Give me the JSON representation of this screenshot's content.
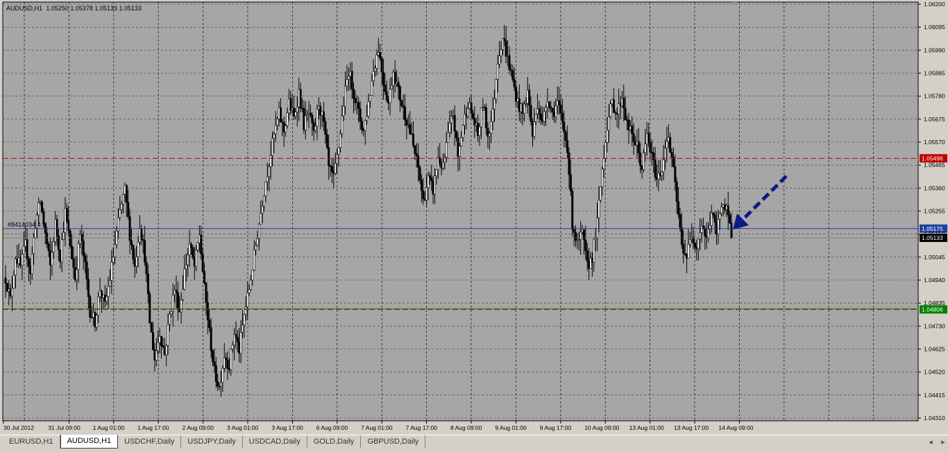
{
  "header": {
    "symbol_label": "AUDUSD,H1",
    "ohlc": "1.05250 1.05378 1.05133 1.05133"
  },
  "order_label": "#8414034 4 sl",
  "colors": {
    "background": "#a6a6a6",
    "grid": "#3a3a3a",
    "candle": "#000000",
    "resistance": "#c00000",
    "support": "#008000",
    "order_line": "#1f3f9f",
    "arrow": "#0b1a88"
  },
  "chart_data": {
    "type": "candlestick",
    "symbol": "AUDUSD",
    "timeframe": "H1",
    "ylim": [
      1.0431,
      1.062
    ],
    "y_ticks": [
      "1.06200",
      "1.06095",
      "1.05990",
      "1.05885",
      "1.05780",
      "1.05675",
      "1.05570",
      "1.05465",
      "1.05360",
      "1.05255",
      "1.05150",
      "1.05045",
      "1.04940",
      "1.04835",
      "1.04730",
      "1.04625",
      "1.04520",
      "1.04415",
      "1.04310"
    ],
    "x_ticks": [
      "30 Jul 2012",
      "31 Jul 09:00",
      "1 Aug 01:00",
      "1 Aug 17:00",
      "2 Aug 09:00",
      "3 Aug 01:00",
      "3 Aug 17:00",
      "6 Aug 09:00",
      "7 Aug 01:00",
      "7 Aug 17:00",
      "8 Aug 09:00",
      "9 Aug 01:00",
      "9 Aug 17:00",
      "10 Aug 09:00",
      "13 Aug 01:00",
      "13 Aug 17:00",
      "14 Aug 09:00"
    ],
    "price_levels": [
      {
        "name": "resistance",
        "value": 1.05496,
        "label": "1.05496"
      },
      {
        "name": "order",
        "value": 1.05175,
        "label": "1.05175"
      },
      {
        "name": "current",
        "value": 1.05133,
        "label": "1.05133"
      },
      {
        "name": "support",
        "value": 1.04806,
        "label": "1.04806"
      }
    ],
    "close_path": [
      1.0495,
      1.0485,
      1.0505,
      1.05,
      1.051,
      1.0498,
      1.052,
      1.053,
      1.0515,
      1.05,
      1.052,
      1.0505,
      1.0525,
      1.051,
      1.0495,
      1.0515,
      1.05,
      1.048,
      1.0475,
      1.049,
      1.0482,
      1.0495,
      1.051,
      1.0525,
      1.0535,
      1.0515,
      1.05,
      1.052,
      1.0505,
      1.0475,
      1.0458,
      1.047,
      1.046,
      1.0478,
      1.049,
      1.048,
      1.0498,
      1.051,
      1.05,
      1.0515,
      1.049,
      1.047,
      1.0452,
      1.0445,
      1.046,
      1.0455,
      1.047,
      1.0462,
      1.0478,
      1.049,
      1.0505,
      1.052,
      1.0535,
      1.0548,
      1.056,
      1.057,
      1.0562,
      1.0575,
      1.0568,
      1.058,
      1.0565,
      1.057,
      1.056,
      1.0575,
      1.0565,
      1.0545,
      1.054,
      1.0555,
      1.0575,
      1.059,
      1.058,
      1.057,
      1.0562,
      1.0575,
      1.059,
      1.06,
      1.0585,
      1.0575,
      1.059,
      1.058,
      1.0572,
      1.0565,
      1.0555,
      1.0545,
      1.053,
      1.054,
      1.0535,
      1.055,
      1.0545,
      1.056,
      1.057,
      1.055,
      1.0565,
      1.0575,
      1.0568,
      1.056,
      1.0575,
      1.056,
      1.057,
      1.0595,
      1.0605,
      1.0595,
      1.0585,
      1.0575,
      1.057,
      1.058,
      1.056,
      1.0575,
      1.0565,
      1.0578,
      1.057,
      1.0575,
      1.0565,
      1.0555,
      1.052,
      1.051,
      1.0515,
      1.05,
      1.0505,
      1.052,
      1.0545,
      1.0565,
      1.0575,
      1.057,
      1.0578,
      1.0565,
      1.056,
      1.0555,
      1.0545,
      1.056,
      1.055,
      1.054,
      1.0545,
      1.056,
      1.055,
      1.053,
      1.051,
      1.0505,
      1.0515,
      1.051,
      1.052,
      1.0512,
      1.0525,
      1.0515,
      1.053,
      1.0525,
      1.0515
    ]
  },
  "tabs": [
    {
      "label": "EURUSD,H1",
      "active": false
    },
    {
      "label": "AUDUSD,H1",
      "active": true
    },
    {
      "label": "USDCHF,Daily",
      "active": false
    },
    {
      "label": "USDJPY,Daily",
      "active": false
    },
    {
      "label": "USDCAD,Daily",
      "active": false
    },
    {
      "label": "GOLD,Daily",
      "active": false
    },
    {
      "label": "GBPUSD,Daily",
      "active": false
    }
  ],
  "nav": {
    "prev": "◂",
    "next": "▸"
  }
}
